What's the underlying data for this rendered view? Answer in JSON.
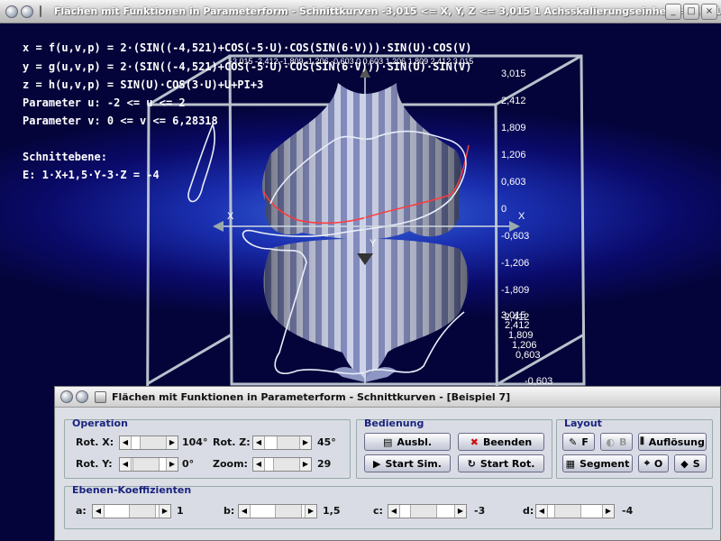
{
  "titlebar": {
    "title": "Flächen mit Funktionen in Parameterform - Schnittkurven   -3,015 <= X, Y, Z <= 3,015    1 Achsskalierungseinheit = 0,301 LE",
    "btn_min": "_",
    "btn_max": "□",
    "btn_close": "×"
  },
  "formulas": {
    "x": "x = f(u,v,p) = 2·(SIN((-4,521)+COS(-5·U)·COS(SIN(6·V)))·SIN(U)·COS(V)",
    "y": "y = g(u,v,p) = 2·(SIN((-4,521)+COS(-5·U)·COS(SIN(6·V)))·SIN(U)·SIN(V)",
    "z": "z = h(u,v,p) = SIN(U)·COS(3·U)+U+PI+3",
    "param_u": "Parameter u: -2 <= u <= 2",
    "param_v": "Parameter v: 0 <= v <= 6,28318",
    "plane_title": "Schnittebene:",
    "plane_eq": "E: 1·X+1,5·Y-3·Z = -4"
  },
  "axes": {
    "right_ticks": [
      "3,015",
      "2,412",
      "1,809",
      "1,206",
      "0,603",
      "0",
      "-0,603",
      "-1,206",
      "-1,809",
      "-2,412"
    ],
    "lower_right_ticks": [
      "3,015",
      "2,412",
      "1,809",
      "1,206",
      "0,603",
      "-0,603"
    ],
    "top_ticks": "-3,015 -2,412 -1,809 -1,206 -0,603 0 0,603 1,206 1,809 2,412 3,015",
    "x_label_right": "X",
    "x_label_left": "X",
    "y_label": "Y"
  },
  "panel": {
    "title": "Flächen mit Funktionen in Parameterform - Schnittkurven - [Beispiel 7]",
    "operation": {
      "label": "Operation",
      "rot_x_label": "Rot. X:",
      "rot_x_value": "104°",
      "rot_y_label": "Rot. Y:",
      "rot_y_value": "0°",
      "rot_z_label": "Rot. Z:",
      "rot_z_value": "45°",
      "zoom_label": "Zoom:",
      "zoom_value": "29"
    },
    "bedienung": {
      "label": "Bedienung",
      "ausbl": "Ausbl.",
      "beenden": "Beenden",
      "start_sim": "Start Sim.",
      "start_rot": "Start Rot."
    },
    "layout": {
      "label": "Layout",
      "f": "F",
      "b": "B",
      "aufloesung": "Auflösung",
      "segment": "Segment",
      "o": "O",
      "s": "S"
    },
    "coeffs": {
      "label": "Ebenen-Koeffizienten",
      "a_label": "a:",
      "a_value": "1",
      "b_label": "b:",
      "b_value": "1,5",
      "c_label": "c:",
      "c_value": "-3",
      "d_label": "d:",
      "d_value": "-4"
    }
  }
}
